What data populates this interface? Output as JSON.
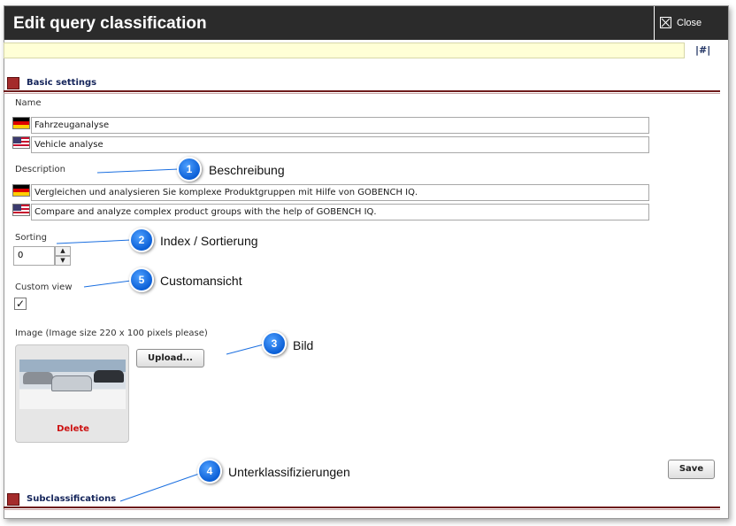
{
  "dialog": {
    "title": "Edit query classification",
    "close_label": "Close",
    "anchor_link": "|#|"
  },
  "basic_settings": {
    "header": "Basic settings",
    "name_label": "Name",
    "name_de": "Fahrzeuganalyse",
    "name_en": "Vehicle analyse",
    "description_label": "Description",
    "description_de": "Vergleichen und analysieren Sie komplexe Produktgruppen mit Hilfe von GOBENCH IQ.",
    "description_en": "Compare and analyze complex product groups with the help of GOBENCH IQ.",
    "sorting_label": "Sorting",
    "sorting_value": "0",
    "spin_up_glyph": "▲",
    "spin_down_glyph": "▼",
    "custom_view_label": "Custom view",
    "custom_view_checked": "✓",
    "image_label": "Image (Image size 220 x 100 pixels please)",
    "upload_button": "Upload...",
    "delete_link": "Delete",
    "save_button": "Save"
  },
  "subclassifications": {
    "header": "Subclassifications"
  },
  "callouts": [
    {
      "number": "1",
      "text": "Beschreibung"
    },
    {
      "number": "2",
      "text": "Index / Sortierung"
    },
    {
      "number": "5",
      "text": "Customansicht"
    },
    {
      "number": "3",
      "text": "Bild"
    },
    {
      "number": "4",
      "text": "Unterklassifizierungen"
    }
  ],
  "colors": {
    "titlebar": "#2b2b2b",
    "section_accent": "#a42b2b",
    "callout_blue": "#0b5fd6",
    "delete_red": "#cc1111",
    "info_bar": "#ffffd6"
  }
}
